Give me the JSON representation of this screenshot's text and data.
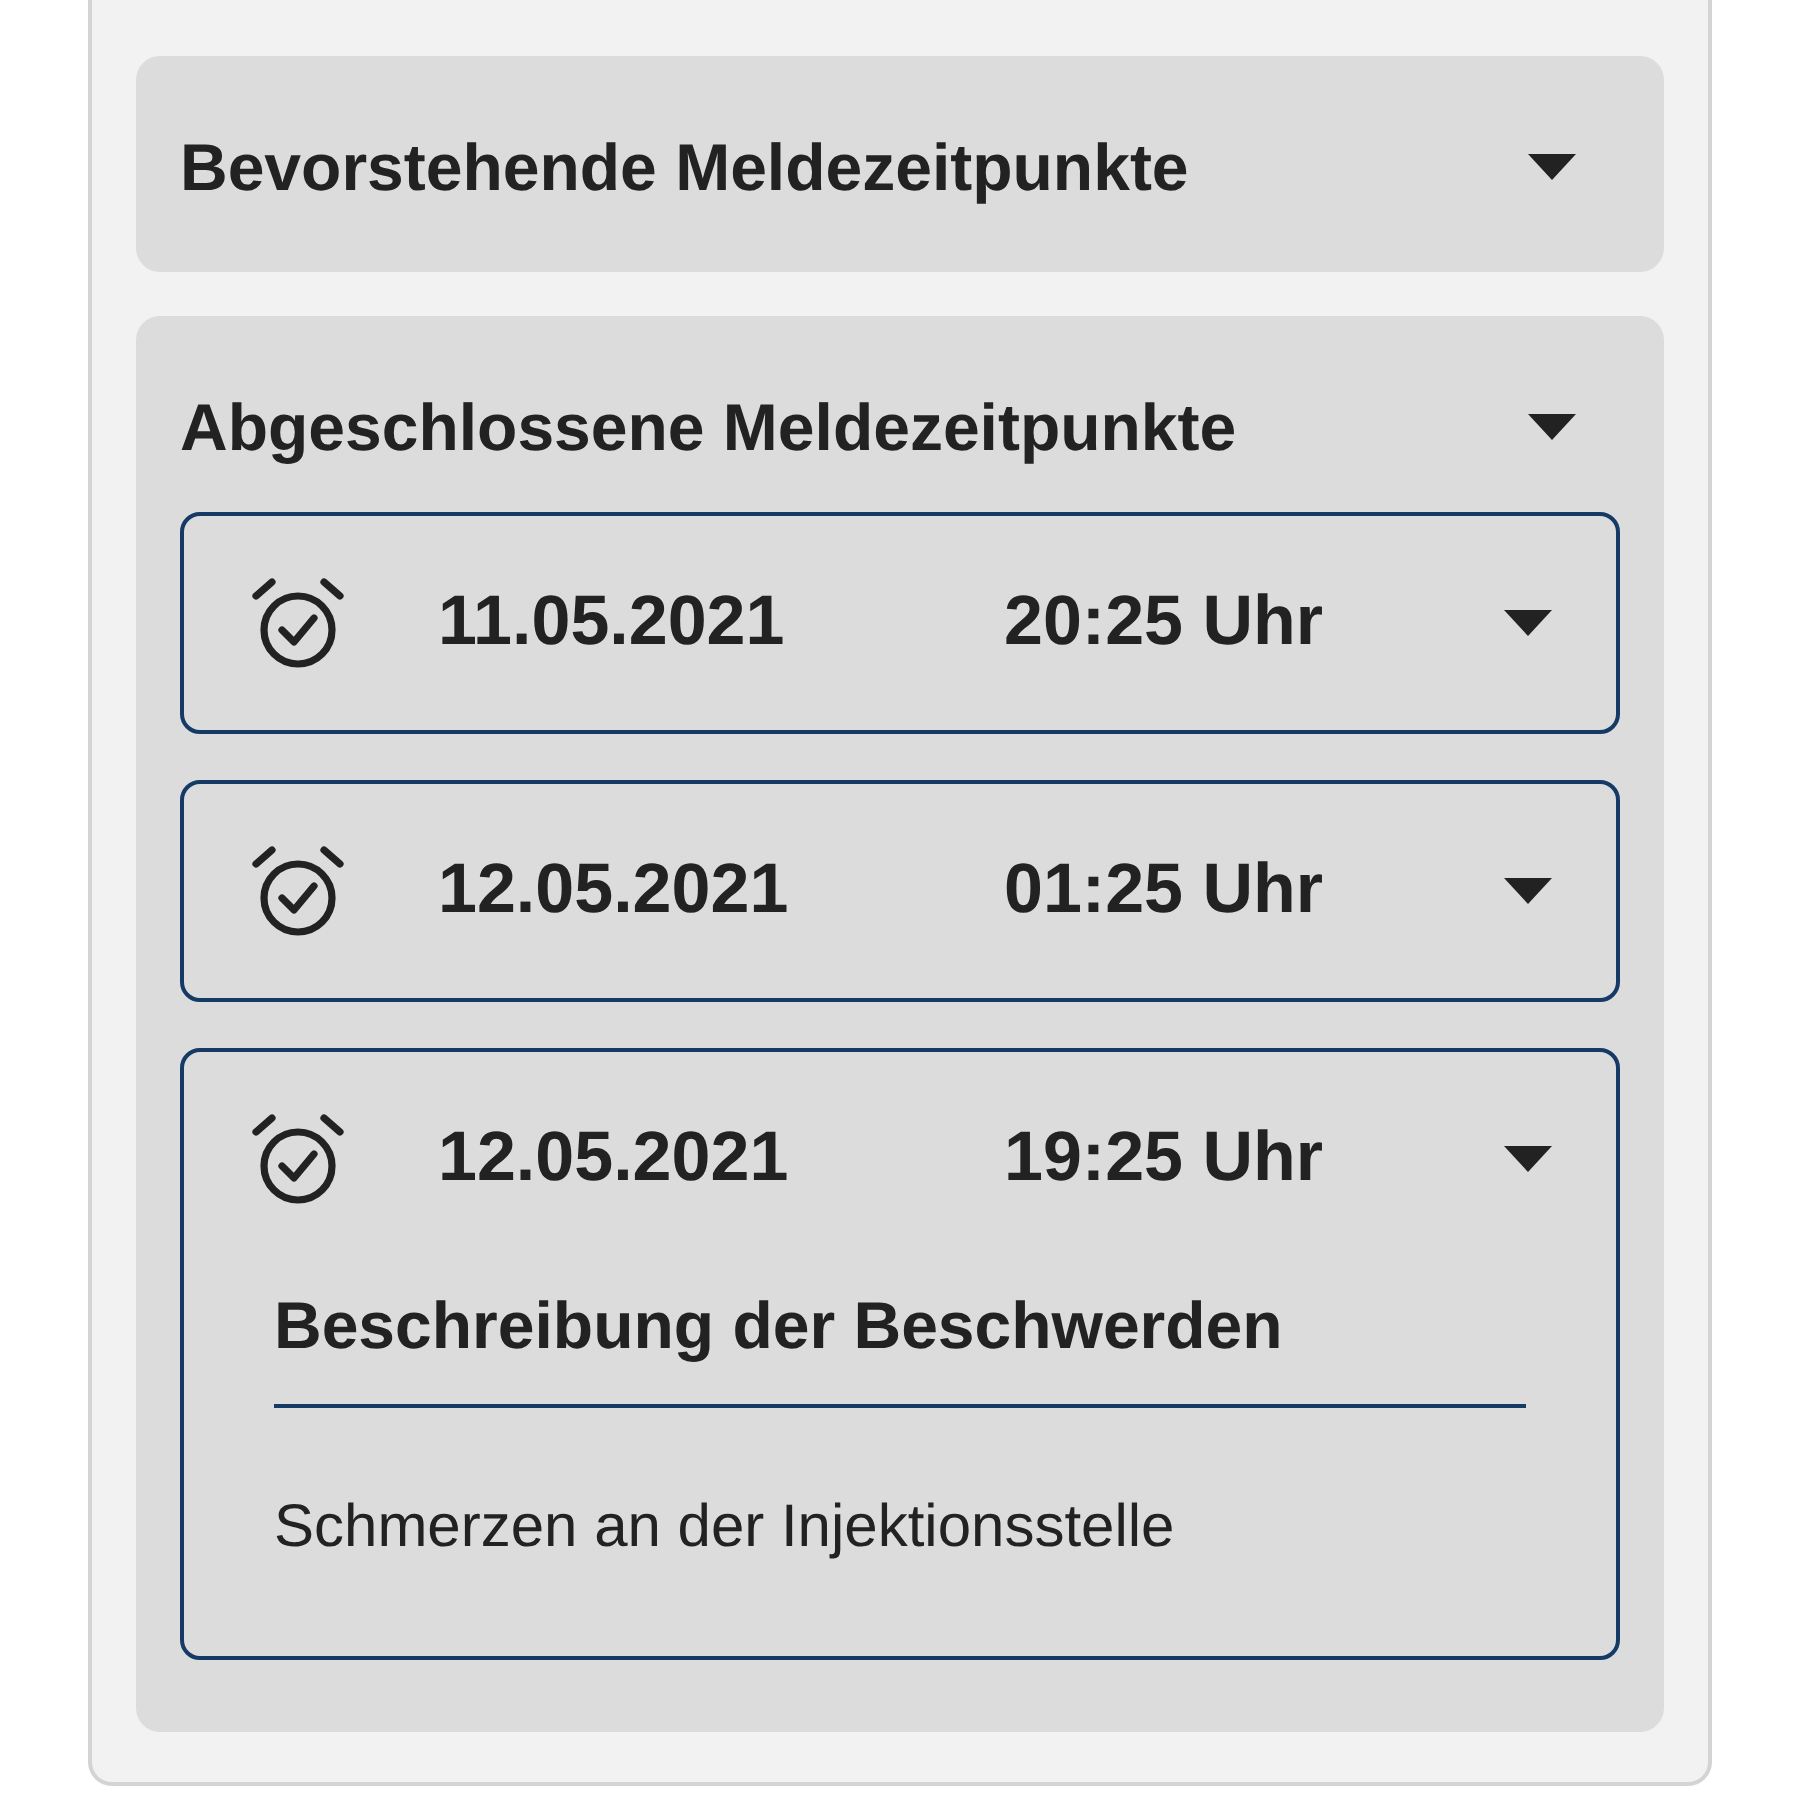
{
  "sections": [
    {
      "title": "Bevorstehende Meldezeitpunkte",
      "expanded": false
    },
    {
      "title": "Abgeschlossene Meldezeitpunkte",
      "expanded": true,
      "entries": [
        {
          "date": "11.05.2021",
          "time": "20:25 Uhr",
          "expanded": false
        },
        {
          "date": "12.05.2021",
          "time": "01:25 Uhr",
          "expanded": false
        },
        {
          "date": "12.05.2021",
          "time": "19:25 Uhr",
          "expanded": true,
          "details": {
            "heading": "Beschreibung der Beschwerden",
            "text": "Schmerzen an der Injektionsstelle"
          }
        }
      ]
    }
  ]
}
